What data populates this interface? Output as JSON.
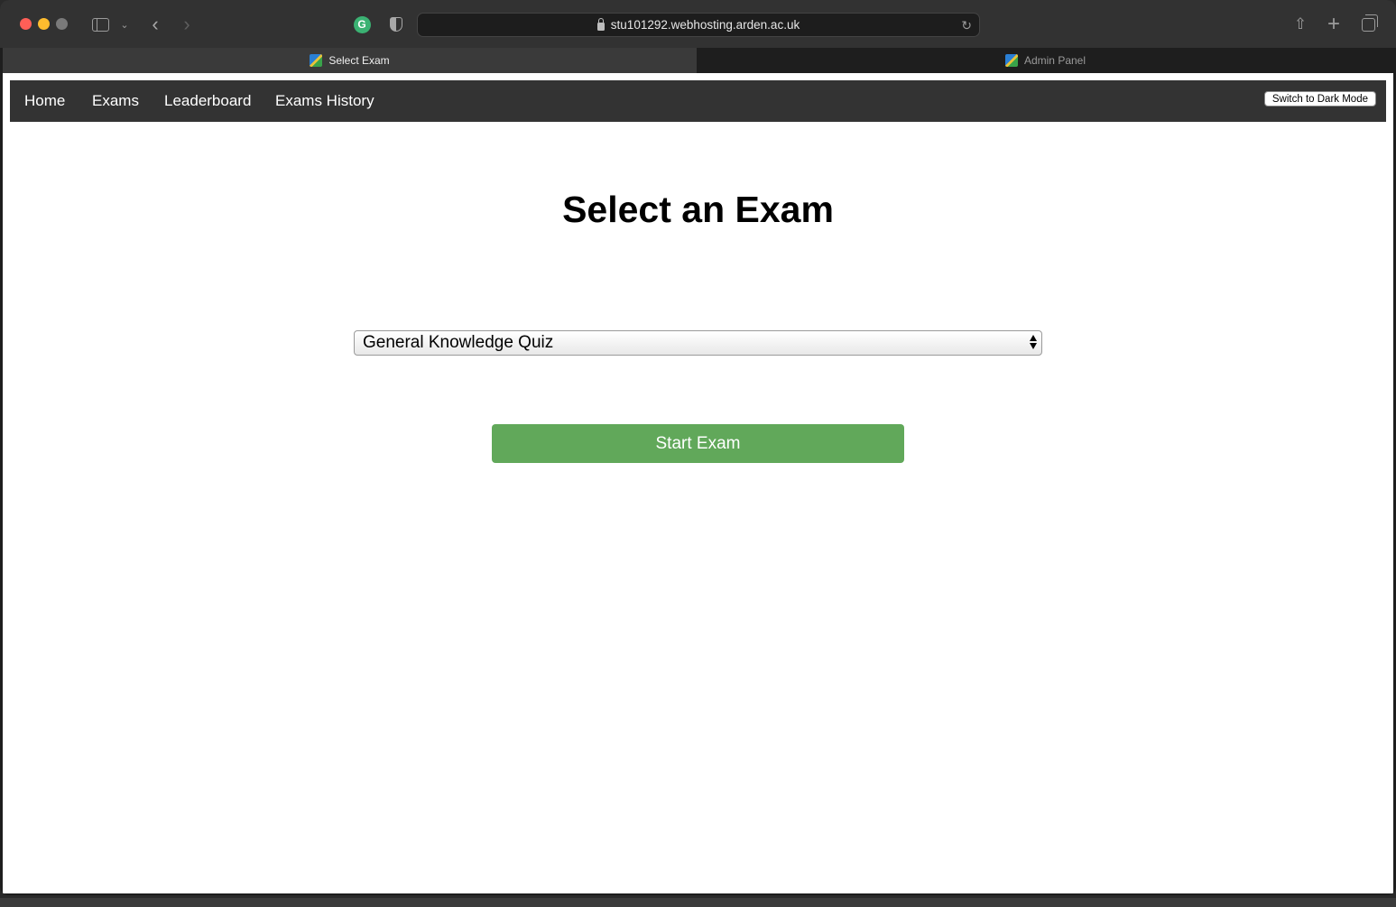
{
  "browser": {
    "url": "stu101292.webhosting.arden.ac.uk",
    "tabs": [
      {
        "label": "Select Exam",
        "active": true
      },
      {
        "label": "Admin Panel",
        "active": false
      }
    ],
    "icons": [
      "sidebar-icon",
      "chevron-down-icon",
      "back-icon",
      "forward-icon",
      "grammarly-icon",
      "shield-icon",
      "lock-icon",
      "reload-icon",
      "share-icon",
      "new-tab-icon",
      "tab-overview-icon"
    ]
  },
  "navbar": {
    "links": [
      "Home",
      "Exams",
      "Leaderboard",
      "Exams History"
    ],
    "dark_mode_button": "Switch to Dark Mode"
  },
  "main": {
    "title": "Select an Exam",
    "exam_select": {
      "selected": "General Knowledge Quiz"
    },
    "start_button": "Start Exam"
  },
  "colors": {
    "navbar_bg": "#333333",
    "start_button_bg": "#61a85a",
    "page_bg": "#ffffff"
  }
}
